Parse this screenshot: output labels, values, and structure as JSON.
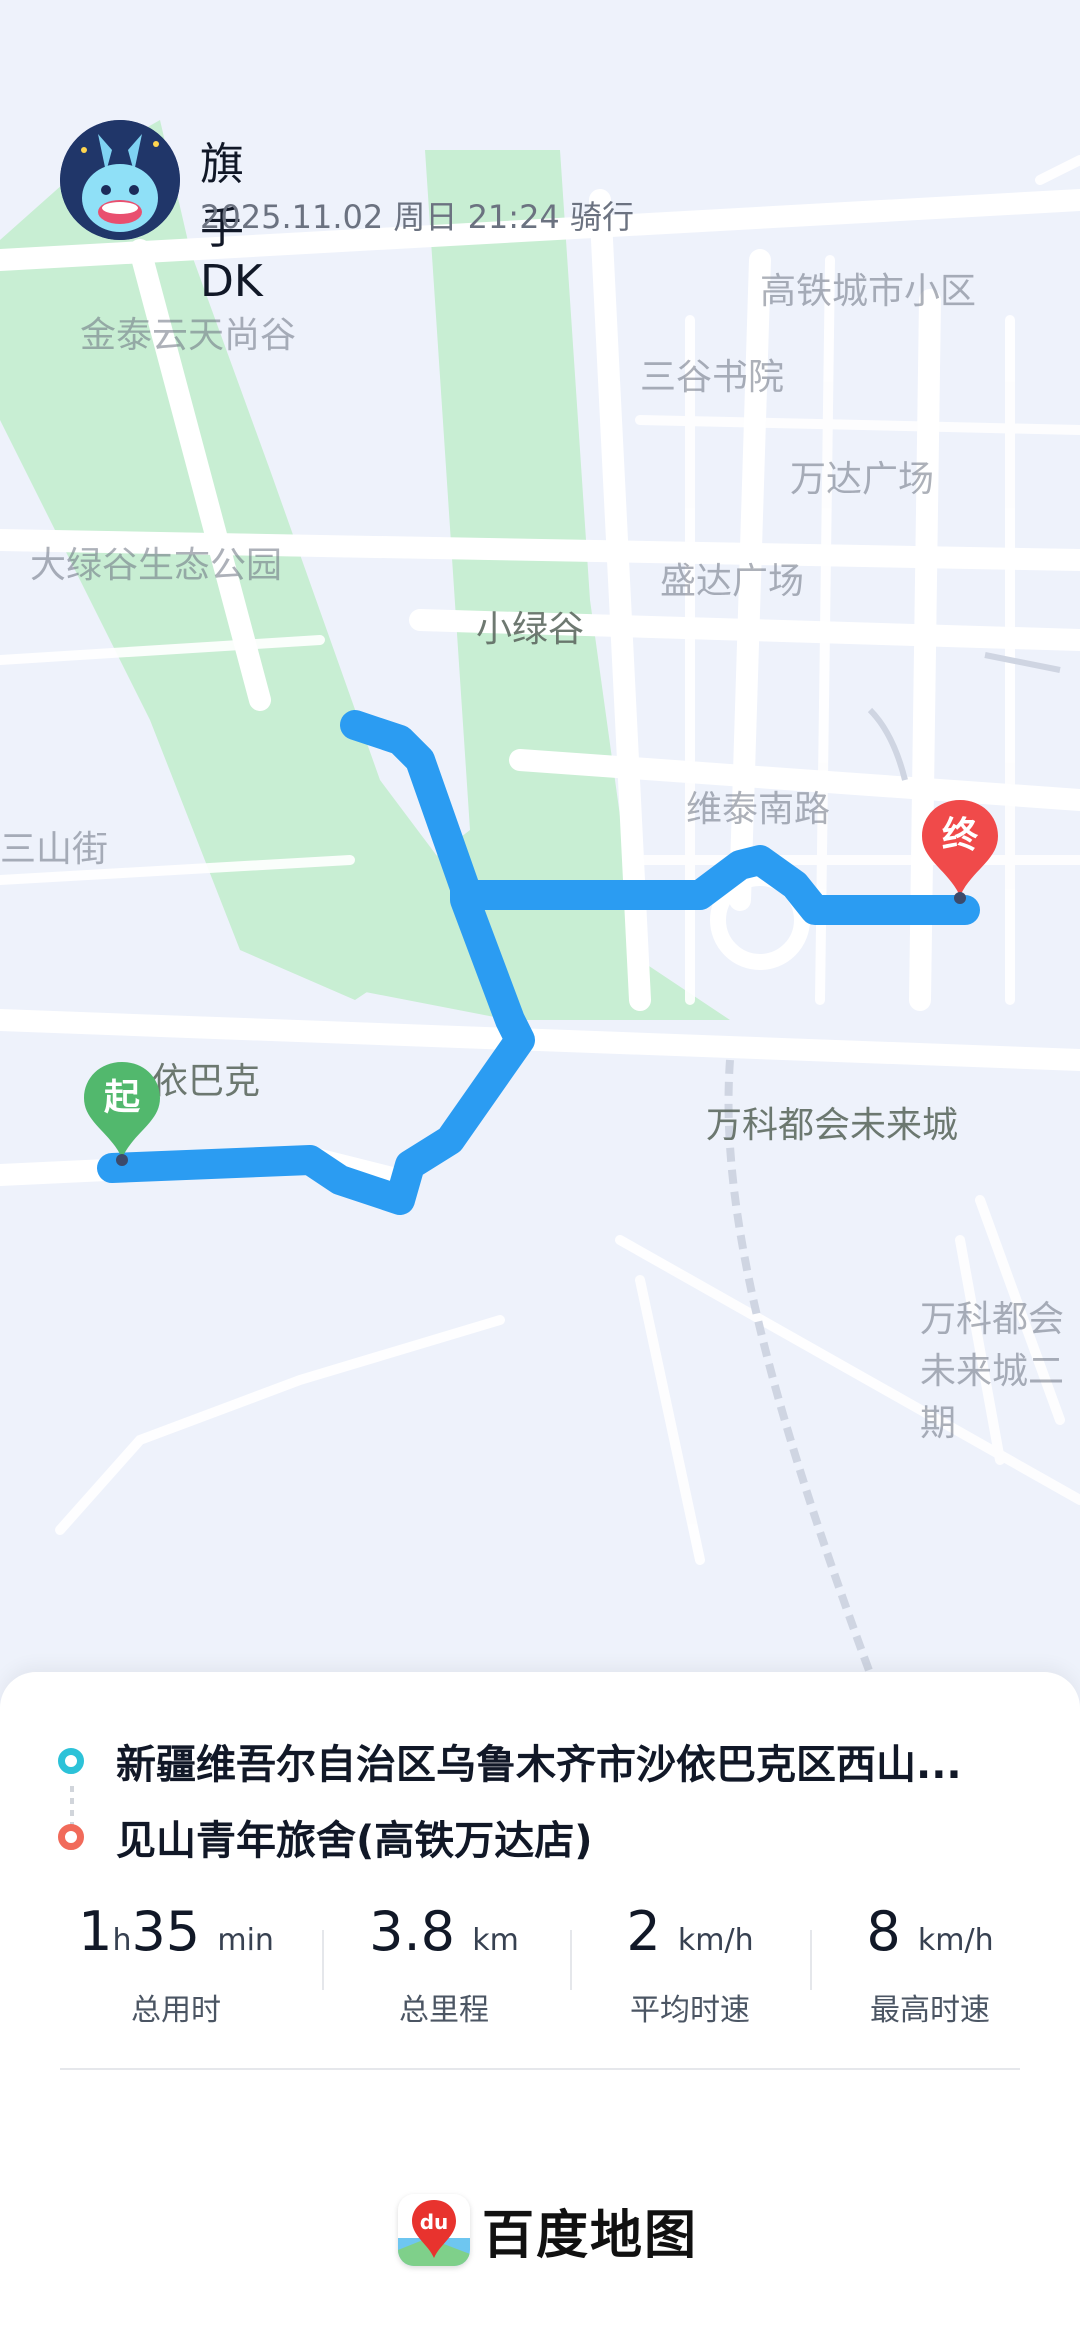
{
  "header": {
    "username": "旗手DK",
    "meta": "2025.11.02 周日 21:24 骑行"
  },
  "map": {
    "labels": {
      "l1": "金泰云天尚谷",
      "l2": "大绿谷生态公园",
      "l3": "小绿谷",
      "l4": "依巴克",
      "l5": "万科都会未来城",
      "l6": "维泰南路",
      "l7": "万达广场",
      "l8": "盛达广场",
      "l9": "三山街",
      "l10": "高铁城市小区",
      "l11": "三谷书院",
      "l12": "万科都会未来城二期"
    },
    "start_pin": "起",
    "end_pin": "终",
    "route_color": "#2b9cf2",
    "start_color": "#52b86d",
    "end_color": "#f04a4a"
  },
  "trip": {
    "start_address": "新疆维吾尔自治区乌鲁木齐市沙依巴克区西山...",
    "end_address": "见山青年旅舍(高铁万达店)"
  },
  "stats": [
    {
      "value": "1",
      "unit": "h",
      "value2": "35",
      "unit2": "min",
      "label": "总用时"
    },
    {
      "value": "3.8",
      "unit": "km",
      "label": "总里程"
    },
    {
      "value": "2",
      "unit": "km/h",
      "label": "平均时速"
    },
    {
      "value": "8",
      "unit": "km/h",
      "label": "最高时速"
    }
  ],
  "brand": {
    "name": "百度地图",
    "logo_text": "du"
  }
}
